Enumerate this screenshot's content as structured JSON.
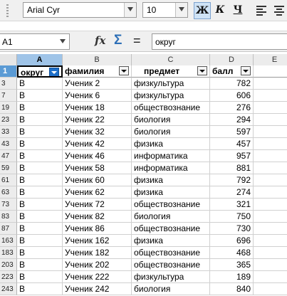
{
  "toolbar": {
    "font_name": "Arial Cyr",
    "font_size": "10",
    "bold_label": "Ж",
    "italic_label": "К",
    "underline_label": "Ч"
  },
  "formula_bar": {
    "name_box": "A1",
    "fx_label": "fx",
    "sum_label": "Σ",
    "equals_label": "=",
    "content": "округ"
  },
  "sheet": {
    "columns": [
      "A",
      "B",
      "C",
      "D",
      "E"
    ],
    "active_column": "A",
    "header_row_number": "1",
    "headers": [
      "округ",
      "фамилия",
      "предмет",
      "балл"
    ],
    "rows": [
      {
        "n": "3",
        "a": "В",
        "b": "Ученик 2",
        "c": "физкультура",
        "d": "782"
      },
      {
        "n": "7",
        "a": "В",
        "b": "Ученик 6",
        "c": "физкультура",
        "d": "606"
      },
      {
        "n": "19",
        "a": "В",
        "b": "Ученик 18",
        "c": "обществознание",
        "d": "276"
      },
      {
        "n": "23",
        "a": "В",
        "b": "Ученик 22",
        "c": "биология",
        "d": "294"
      },
      {
        "n": "33",
        "a": "В",
        "b": "Ученик 32",
        "c": "биология",
        "d": "597"
      },
      {
        "n": "43",
        "a": "В",
        "b": "Ученик 42",
        "c": "физика",
        "d": "457"
      },
      {
        "n": "47",
        "a": "В",
        "b": "Ученик 46",
        "c": "информатика",
        "d": "957"
      },
      {
        "n": "59",
        "a": "В",
        "b": "Ученик 58",
        "c": "информатика",
        "d": "881"
      },
      {
        "n": "61",
        "a": "В",
        "b": "Ученик 60",
        "c": "физика",
        "d": "792"
      },
      {
        "n": "63",
        "a": "В",
        "b": "Ученик 62",
        "c": "физика",
        "d": "274"
      },
      {
        "n": "73",
        "a": "В",
        "b": "Ученик 72",
        "c": "обществознание",
        "d": "321"
      },
      {
        "n": "83",
        "a": "В",
        "b": "Ученик 82",
        "c": "биология",
        "d": "750"
      },
      {
        "n": "87",
        "a": "В",
        "b": "Ученик 86",
        "c": "обществознание",
        "d": "730"
      },
      {
        "n": "163",
        "a": "В",
        "b": "Ученик 162",
        "c": "физика",
        "d": "696"
      },
      {
        "n": "183",
        "a": "В",
        "b": "Ученик 182",
        "c": "обществознание",
        "d": "468"
      },
      {
        "n": "203",
        "a": "В",
        "b": "Ученик 202",
        "c": "обществознание",
        "d": "365"
      },
      {
        "n": "223",
        "a": "В",
        "b": "Ученик 222",
        "c": "физкультура",
        "d": "189"
      },
      {
        "n": "243",
        "a": "В",
        "b": "Ученик 242",
        "c": "биология",
        "d": "840"
      }
    ]
  },
  "colors": {
    "selection_header": "#5b9bd5",
    "active_filter": "#1f6fc8",
    "bold_active": "#cfe3f6"
  },
  "icons": {
    "function_wizard": "fx-icon",
    "sum": "sum-icon",
    "formula": "equals-icon",
    "filter": "filter-dropdown-icon"
  }
}
